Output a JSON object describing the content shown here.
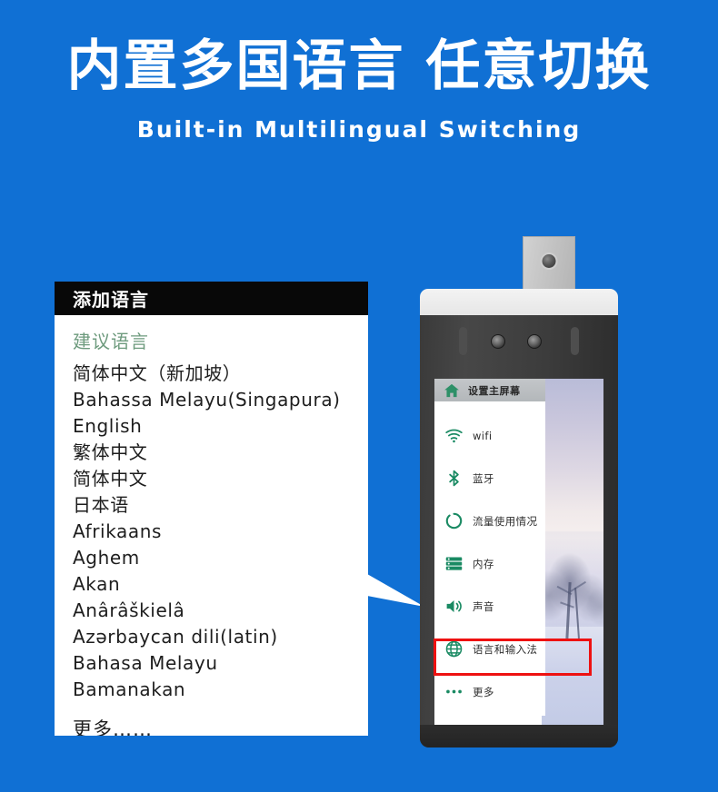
{
  "header": {
    "title_cn": "内置多国语言 任意切换",
    "title_en": "Built-in Multilingual Switching"
  },
  "colors": {
    "background_blue": "#1070D4",
    "accent_green": "#1A8A63",
    "section_green": "#6E9B7E",
    "highlight_red": "#EE1111",
    "titlebar_black": "#080808"
  },
  "language_panel": {
    "title": "添加语言",
    "section_header": "建议语言",
    "items": [
      "简体中文（新加坡）",
      "Bahassa Melayu(Singapura)",
      "English",
      "繁体中文",
      "简体中文",
      "日本语",
      "Afrikaans",
      "Aghem",
      "Akan",
      "Anârâškielâ",
      "Azərbaycan dili(latin)",
      "Bahasa Melayu",
      "Bamanakan"
    ],
    "more_label": "更多……"
  },
  "device": {
    "screen": {
      "menu_header": {
        "icon": "home-icon",
        "label": "设置主屏幕"
      },
      "menu_items": [
        {
          "icon": "wifi-icon",
          "label": "wifi",
          "highlighted": false
        },
        {
          "icon": "bluetooth-icon",
          "label": "蓝牙",
          "highlighted": false
        },
        {
          "icon": "data-usage-icon",
          "label": "流量使用情况",
          "highlighted": false
        },
        {
          "icon": "storage-icon",
          "label": "内存",
          "highlighted": false
        },
        {
          "icon": "sound-icon",
          "label": "声音",
          "highlighted": false
        },
        {
          "icon": "globe-icon",
          "label": "语言和输入法",
          "highlighted": true
        },
        {
          "icon": "more-dots-icon",
          "label": "更多",
          "highlighted": false
        }
      ],
      "wallpaper": "winter-snow-trees-photo"
    },
    "hardware": {
      "bracket": "wall-mount-bracket",
      "screw": "bracket-screw",
      "cameras": [
        "camera-lens-1",
        "camera-lens-2"
      ],
      "sensors": [
        "sensor-slot-left",
        "sensor-slot-right"
      ]
    }
  },
  "callout": {
    "shape": "arrow-pointer-triangle",
    "direction": "right"
  }
}
